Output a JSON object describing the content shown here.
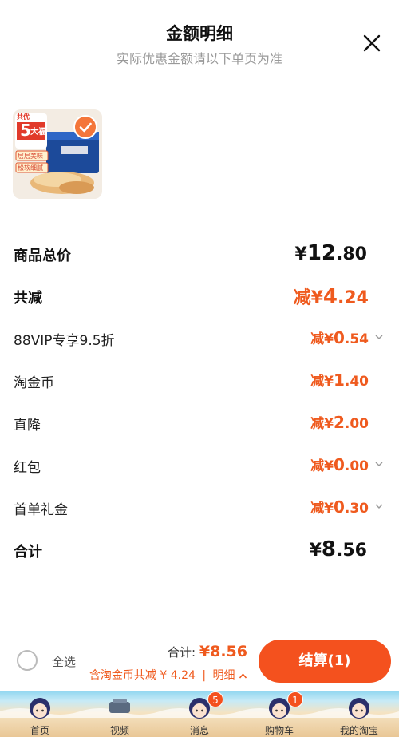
{
  "header": {
    "title": "金额明细",
    "subtitle": "实际优惠金额请以下单页为准"
  },
  "product": {
    "badge_top": "共优",
    "badge_number": "5",
    "badge_text": "大福",
    "tag1": "层层美味",
    "tag2": "松软细腻",
    "checked": true
  },
  "rows": [
    {
      "label": "商品总价",
      "prefix": "",
      "yen": "¥",
      "int": "12",
      "dec": ".80",
      "bold": true,
      "color": "black"
    },
    {
      "label": "共减",
      "prefix": "减",
      "yen": "¥",
      "int": "4",
      "dec": ".24",
      "bold": true,
      "color": "orange"
    },
    {
      "label": "88VIP专享9.5折",
      "prefix": "减",
      "yen": "¥",
      "int": "0",
      "dec": ".54",
      "bold": false,
      "color": "orange",
      "chevron": true
    },
    {
      "label": "淘金币",
      "prefix": "减",
      "yen": "¥",
      "int": "1",
      "dec": ".40",
      "bold": false,
      "color": "orange"
    },
    {
      "label": "直降",
      "prefix": "减",
      "yen": "¥",
      "int": "2",
      "dec": ".00",
      "bold": false,
      "color": "orange"
    },
    {
      "label": "红包",
      "prefix": "减",
      "yen": "¥",
      "int": "0",
      "dec": ".00",
      "bold": false,
      "color": "orange",
      "chevron": true
    },
    {
      "label": "首单礼金",
      "prefix": "减",
      "yen": "¥",
      "int": "0",
      "dec": ".30",
      "bold": false,
      "color": "orange",
      "chevron": true
    },
    {
      "label": "合计",
      "prefix": "",
      "yen": "¥",
      "int": "8",
      "dec": ".56",
      "bold": true,
      "color": "black"
    }
  ],
  "bottom_bar": {
    "select_all": "全选",
    "total_label": "合计:",
    "total_amount": "¥8.56",
    "discount_text": "含淘金币共减 ¥ 4.24",
    "detail_link": "明细",
    "checkout": "结算(1)"
  },
  "tabbar": [
    {
      "label": "首页",
      "badge": ""
    },
    {
      "label": "视频",
      "badge": ""
    },
    {
      "label": "消息",
      "badge": "5"
    },
    {
      "label": "购物车",
      "badge": "1"
    },
    {
      "label": "我的淘宝",
      "badge": ""
    }
  ],
  "colors": {
    "accent": "#f4511e",
    "price_orange": "#ef5a1e"
  }
}
